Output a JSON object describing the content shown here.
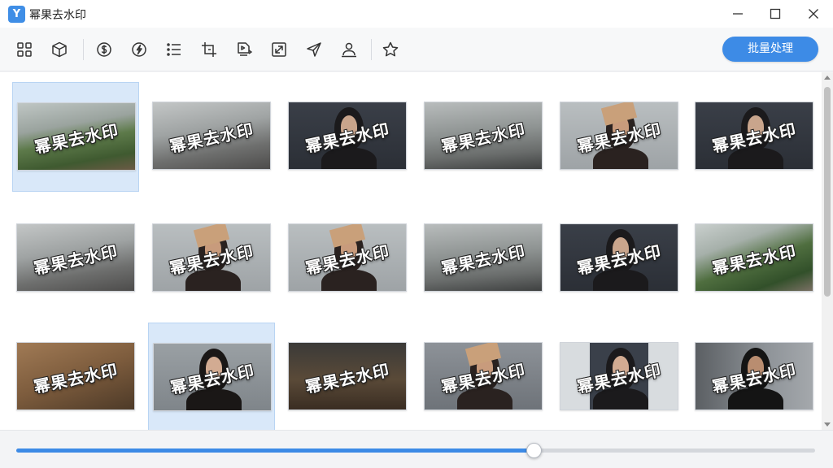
{
  "window": {
    "title": "幂果去水印",
    "logo_glyph": "Y",
    "accent_color": "#3d8be6"
  },
  "toolbar": {
    "tools": [
      {
        "name": "grid-view-icon"
      },
      {
        "name": "cube-icon"
      },
      {
        "name": "dollar-circle-icon"
      },
      {
        "name": "lightning-circle-icon"
      },
      {
        "name": "list-icon"
      },
      {
        "name": "crop-icon"
      },
      {
        "name": "video-file-icon"
      },
      {
        "name": "resize-icon"
      },
      {
        "name": "send-icon"
      },
      {
        "name": "user-upload-icon"
      },
      {
        "name": "star-icon"
      }
    ],
    "batch_label": "批量处理"
  },
  "grid": {
    "watermark_text": "幂果去水印",
    "items": [
      {
        "scene": "park",
        "selected": true
      },
      {
        "scene": "street",
        "selected": false
      },
      {
        "scene": "woman-dark",
        "selected": false
      },
      {
        "scene": "street-grey",
        "selected": false
      },
      {
        "scene": "woman-cover",
        "selected": false
      },
      {
        "scene": "woman-dark",
        "selected": false
      },
      {
        "scene": "street",
        "selected": false
      },
      {
        "scene": "woman-cover",
        "selected": false
      },
      {
        "scene": "woman-cover",
        "selected": false
      },
      {
        "scene": "street-grey",
        "selected": false
      },
      {
        "scene": "woman-dark",
        "selected": false
      },
      {
        "scene": "park-rail",
        "selected": false
      },
      {
        "scene": "paper-hands",
        "selected": false
      },
      {
        "scene": "woman-portrait",
        "selected": true
      },
      {
        "scene": "desk",
        "selected": false
      },
      {
        "scene": "hands-cover",
        "selected": false
      },
      {
        "scene": "woman-door",
        "selected": false
      },
      {
        "scene": "man-portrait",
        "selected": false
      }
    ]
  },
  "slider": {
    "value_fraction": 0.648
  }
}
